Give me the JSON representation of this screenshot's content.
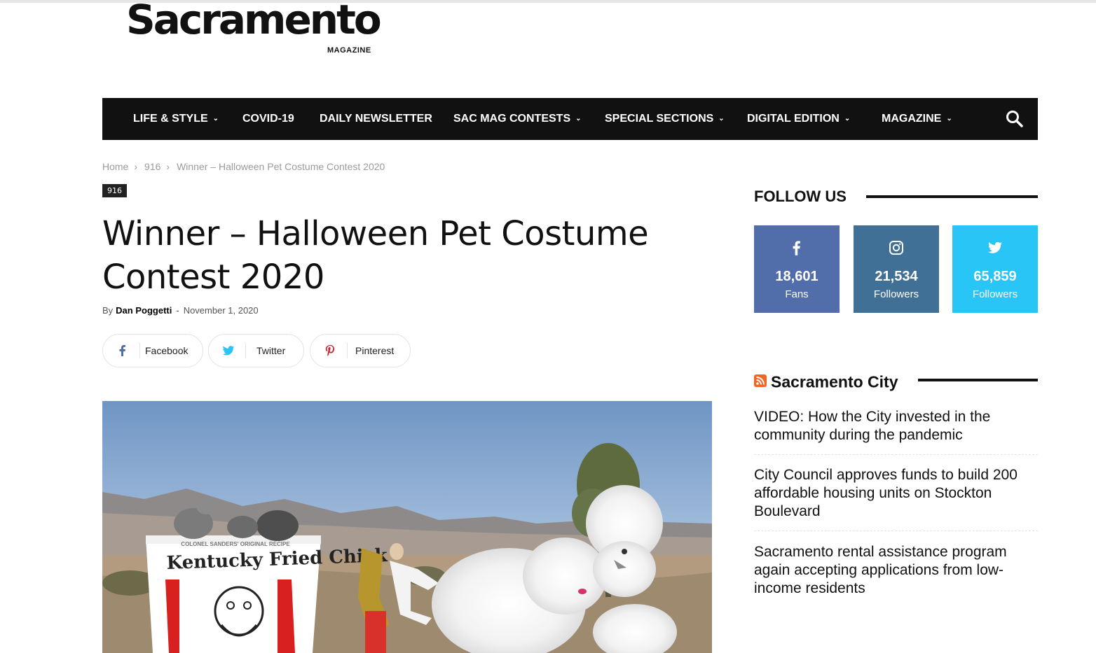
{
  "logo": {
    "word": "Sacramento",
    "sub": "MAGAZINE"
  },
  "nav": {
    "items": [
      {
        "label": "LIFE & STYLE",
        "dropdown": true
      },
      {
        "label": "COVID-19",
        "dropdown": false
      },
      {
        "label": "DAILY NEWSLETTER",
        "dropdown": false
      },
      {
        "label": "SAC MAG CONTESTS",
        "dropdown": true
      },
      {
        "label": "SPECIAL SECTIONS",
        "dropdown": true
      },
      {
        "label": "DIGITAL EDITION",
        "dropdown": true
      },
      {
        "label": "MAGAZINE",
        "dropdown": true
      }
    ],
    "chevron": "⌄"
  },
  "breadcrumb": {
    "home": "Home",
    "section": "916",
    "current": "Winner – Halloween Pet Costume Contest 2020",
    "sep": "›"
  },
  "article": {
    "category": "916",
    "title": "Winner – Halloween Pet Costume Contest 2020",
    "by": "By",
    "author": "Dan Poggetti",
    "dash": "-",
    "date": "November 1, 2020"
  },
  "share": {
    "facebook": "Facebook",
    "twitter": "Twitter",
    "pinterest": "Pinterest"
  },
  "hero": {
    "bucket_top": "COLONEL SANDERS' ORIGINAL RECIPE",
    "bucket_brand": "Kentucky Fried Chick"
  },
  "sidebar": {
    "follow_title": "FOLLOW US",
    "follow": [
      {
        "network": "facebook",
        "icon": "facebook-icon",
        "count": "18,601",
        "unit": "Fans",
        "color": "#516eab"
      },
      {
        "network": "instagram",
        "icon": "instagram-icon",
        "count": "21,534",
        "unit": "Followers",
        "color": "#417096"
      },
      {
        "network": "twitter",
        "icon": "twitter-icon",
        "count": "65,859",
        "unit": "Followers",
        "color": "#29c5f6"
      }
    ],
    "rss_title": "Sacramento City",
    "news": [
      "VIDEO: How the City invested in the community during the pandemic",
      "City Council approves funds to build 200 affordable housing units on Stockton Boulevard",
      "Sacramento rental assistance program again accepting applications from low-income residents"
    ]
  }
}
